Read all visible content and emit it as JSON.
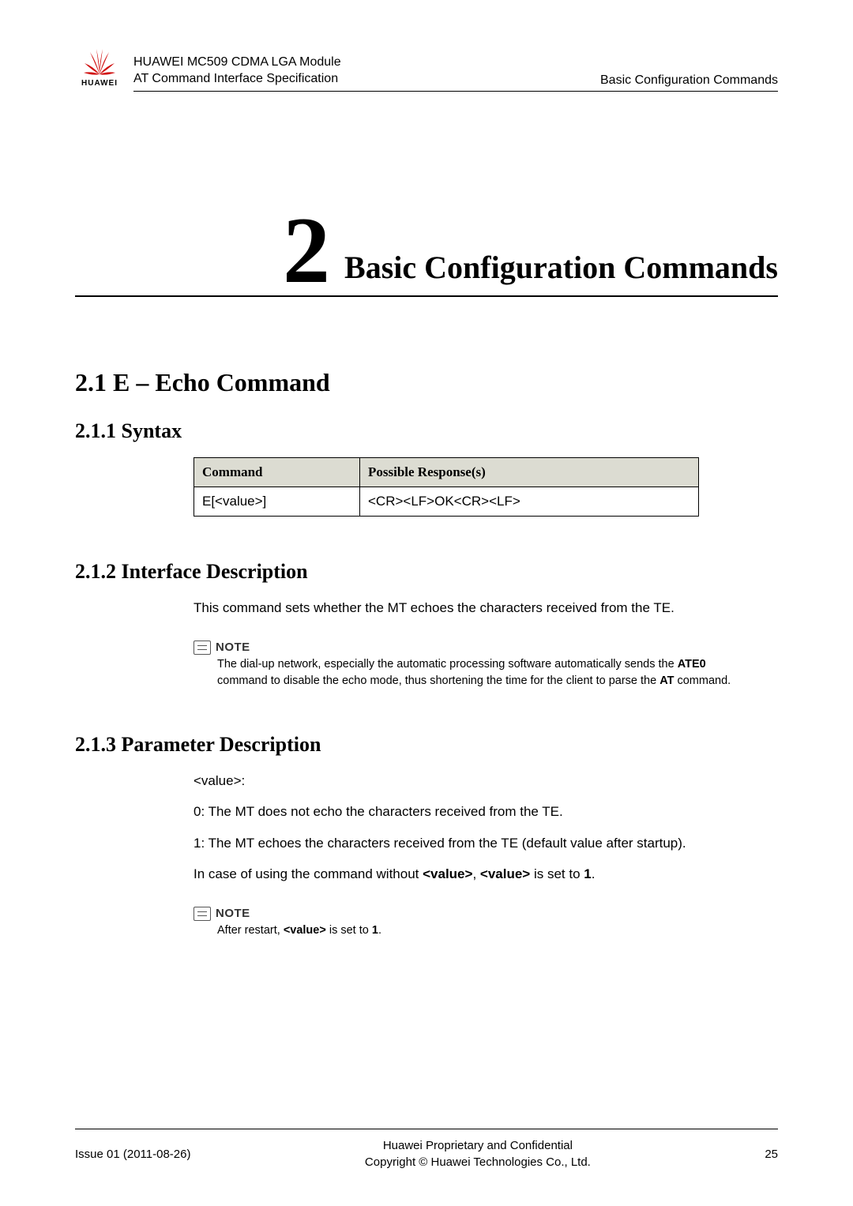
{
  "header": {
    "doc_line1": "HUAWEI MC509 CDMA LGA Module",
    "doc_line2": "AT Command Interface Specification",
    "section_label": "Basic Configuration Commands",
    "brand": "HUAWEI"
  },
  "chapter": {
    "number": "2",
    "title": "Basic Configuration Commands"
  },
  "sections": {
    "s2_1": {
      "heading": "2.1 E – Echo Command"
    },
    "s2_1_1": {
      "heading": "2.1.1 Syntax",
      "table": {
        "col1_header": "Command",
        "col2_header": "Possible Response(s)",
        "row1_col1": "E[<value>]",
        "row1_col2": "<CR><LF>OK<CR><LF>"
      }
    },
    "s2_1_2": {
      "heading": "2.1.2 Interface Description",
      "para": "This command sets whether the MT echoes the characters received from the TE.",
      "note_label": "NOTE",
      "note_text_pre": "The dial-up network, especially the automatic processing software automatically sends the ",
      "note_bold1": "ATE0",
      "note_text_mid": " command to disable the echo mode, thus shortening the time for the client to parse the ",
      "note_bold2": "AT",
      "note_text_post": " command."
    },
    "s2_1_3": {
      "heading": "2.1.3 Parameter Description",
      "line_value": "<value>:",
      "line_0": "0: The MT does not echo the characters received from the TE.",
      "line_1": "1: The MT echoes the characters received from the TE (default value after startup).",
      "line_case_pre": "In case of using the command without ",
      "bold_value1": "<value>",
      "line_case_mid": ", ",
      "bold_value2": "<value>",
      "line_case_mid2": " is set to ",
      "bold_one": "1",
      "line_case_post": ".",
      "note_label": "NOTE",
      "note2_pre": "After restart, ",
      "note2_bold": "<value>",
      "note2_mid": " is set to ",
      "note2_bold2": "1",
      "note2_post": "."
    }
  },
  "footer": {
    "left": "Issue 01 (2011-08-26)",
    "center_line1": "Huawei Proprietary and Confidential",
    "center_line2": "Copyright © Huawei Technologies Co., Ltd.",
    "right": "25"
  }
}
